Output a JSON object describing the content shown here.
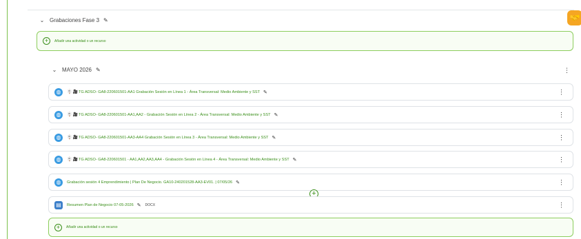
{
  "section_phase": {
    "title": "Grabaciones Fase 3"
  },
  "add_activity_label": "Añadir una actividad o un recurso",
  "subsection": {
    "title": "MAYO 2026"
  },
  "activities": [
    {
      "title": "TG ADSO- GA8-220601501-AA1 Grabación Sesión en Línea 1 - Área Transversal: Medio Ambiente y SST",
      "type": "url"
    },
    {
      "title": "TG ADSO- GA8-220601501-AA1,AA2 - Grabación Sesión en Línea 2 - Área Transversal: Medio Ambiente y SST",
      "type": "url"
    },
    {
      "title": "TG ADSO- GA8-220601501-AA3-AA4 Grabación Sesión en Línea 3 - Área Transversal: Medio Ambiente y SST",
      "type": "url"
    },
    {
      "title": "TG ADSO- GA8-220601501 - AA1,AA2,AA3,AA4 - Grabación Sesión en Línea 4 - Área Transversal: Medio Ambiente y SST",
      "type": "url"
    },
    {
      "title": "Grabación sesión 4 Emprendimiento | Plan De Negocio. GA10-240201528-AA3-EV01. | 07/05/26",
      "type": "url"
    },
    {
      "title": "Resumen Plan de Negocio 07-05-2026",
      "type": "file",
      "badge": "DOCX"
    }
  ],
  "colors": {
    "accent_green": "#3a8f1a",
    "link_green": "#3a8f1a",
    "url_icon_blue": "#399be2",
    "assist_orange": "#f5a623"
  }
}
